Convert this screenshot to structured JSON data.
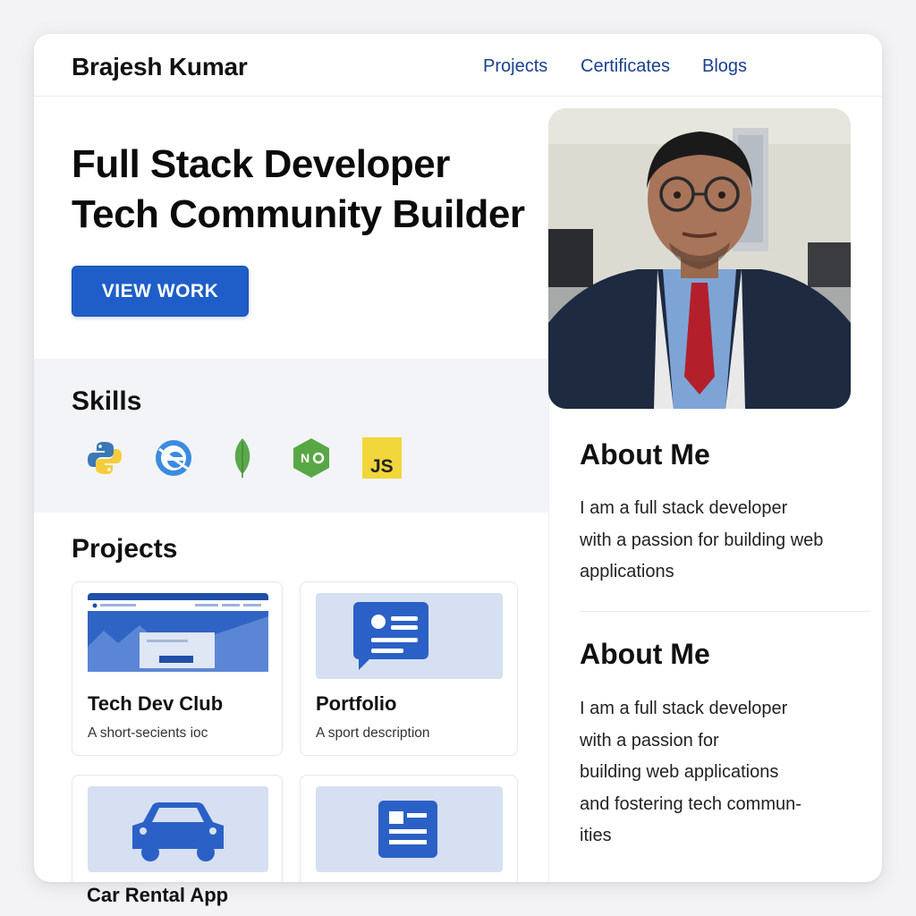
{
  "header": {
    "brand": "Brajesh Kumar",
    "nav": [
      "Projects",
      "Certificates",
      "Blogs"
    ]
  },
  "hero": {
    "title_line1": "Full Stack Developer",
    "title_line2": "Tech Community Builder",
    "cta": "VIEW WORK"
  },
  "skills": {
    "title": "Skills",
    "icons": [
      "python-icon",
      "edge-browser-icon",
      "mongodb-leaf-icon",
      "nodejs-icon",
      "javascript-icon"
    ]
  },
  "projects": {
    "title": "Projects",
    "cards": [
      {
        "title": "Tech Dev Club",
        "description": "A short-secients    ioc",
        "thumb": "website-mockup"
      },
      {
        "title": "Portfolio",
        "description": "A sport description",
        "thumb": "profile-card-icon"
      },
      {
        "title": "Car Rental App",
        "description": "",
        "thumb": "car-icon"
      },
      {
        "title": "",
        "description": "",
        "thumb": "document-icon"
      }
    ]
  },
  "about": [
    {
      "title": "About Me",
      "lines": [
        "I am a full stack developer",
        "with a passion for building web",
        "applications"
      ]
    },
    {
      "title": "About Me",
      "lines": [
        "I am a full stack developer",
        "with a passion for",
        "building web applications",
        "and fostering tech commun‑",
        "ities"
      ]
    }
  ],
  "colors": {
    "accent": "#1f5ec8",
    "nav": "#1a3f8f",
    "thumb_bg": "#d6e0f2",
    "band_bg": "#f3f4f8"
  }
}
